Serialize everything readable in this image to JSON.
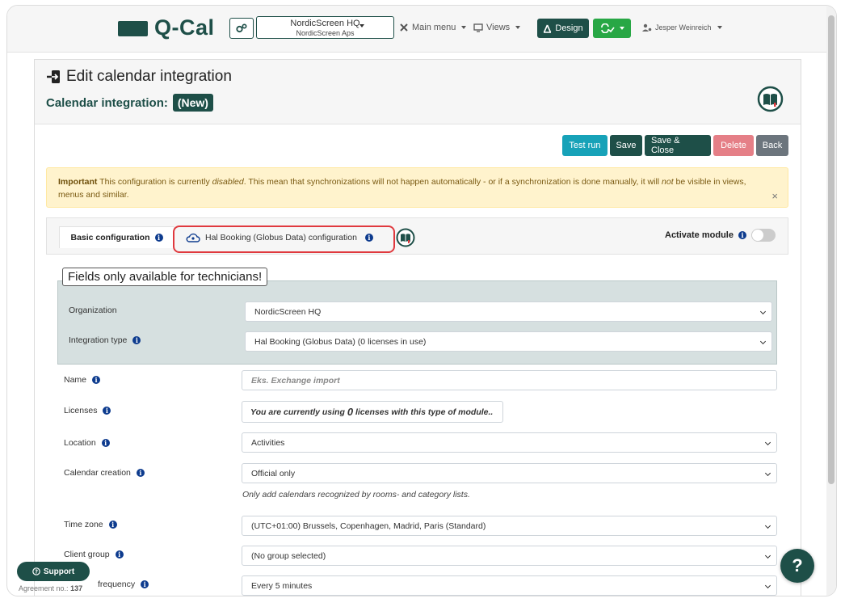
{
  "colors": {
    "brand": "#1e4f48",
    "info": "#17a2b8",
    "danger_light": "#e57f87",
    "secondary": "#6c757d",
    "success": "#28a745",
    "warning_bg": "#fff3cd",
    "highlight": "#e0393e"
  },
  "nav": {
    "logo": "Q-Cal",
    "org_name": "NordicScreen HQ",
    "org_sub": "NordicScreen Aps",
    "main_menu": "Main menu",
    "views": "Views",
    "design": "Design",
    "user": "Jesper Weinreich"
  },
  "page": {
    "title": "Edit calendar integration",
    "subtitle": "Calendar integration:",
    "badge": "(New)"
  },
  "actions": {
    "test_run": "Test run",
    "save": "Save",
    "save_close": "Save & Close",
    "delete": "Delete",
    "back": "Back"
  },
  "alert": {
    "strong": "Important",
    "t1": " This configuration is currently ",
    "em1": "disabled",
    "t2": ". This mean that synchronizations will not happen automatically - or if a synchronization is done manually, it will ",
    "em2": "not",
    "t3": " be visible in views, menus and similar.",
    "close": "×"
  },
  "tabs": {
    "basic": "Basic configuration",
    "hal": "Hal Booking (Globus Data) configuration",
    "activate": "Activate module",
    "activate_on": false
  },
  "tech": {
    "legend": "Fields only available for technicians!",
    "org_label": "Organization",
    "org_value": "NordicScreen HQ",
    "type_label": "Integration type",
    "type_value": "Hal Booking (Globus Data) (0 licenses in use)"
  },
  "form": {
    "name_label": "Name",
    "name_placeholder": "Eks. Exchange import",
    "licenses_label": "Licenses",
    "licenses_pre": "You are currently using ",
    "licenses_count": "0",
    "licenses_post": " licenses with this type of module..",
    "location_label": "Location",
    "location_value": "Activities",
    "calcreation_label": "Calendar creation",
    "calcreation_value": "Official only",
    "calcreation_help": "Only add calendars recognized by rooms- and category lists.",
    "timezone_label": "Time zone",
    "timezone_value": "(UTC+01:00) Brussels, Copenhagen, Madrid, Paris (Standard)",
    "clientgroup_label": "Client group",
    "clientgroup_value": "(No group selected)",
    "frequency_label": "frequency",
    "frequency_value": "Every 5 minutes"
  },
  "footer": {
    "support": "Support",
    "agreement_label": "Agreement no.:",
    "agreement_no": "137",
    "help": "?"
  }
}
